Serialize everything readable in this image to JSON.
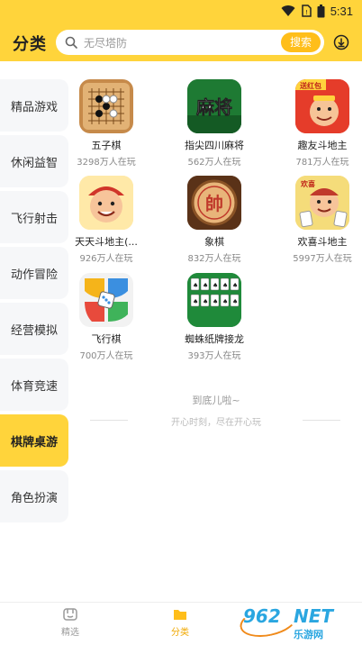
{
  "status_bar": {
    "time": "5:31"
  },
  "header": {
    "title": "分类",
    "search_placeholder": "无尽塔防",
    "search_button": "搜索"
  },
  "sidebar": {
    "items": [
      {
        "label": "精品游戏"
      },
      {
        "label": "休闲益智"
      },
      {
        "label": "飞行射击"
      },
      {
        "label": "动作冒险"
      },
      {
        "label": "经营模拟"
      },
      {
        "label": "体育竞速"
      },
      {
        "label": "棋牌桌游"
      },
      {
        "label": "角色扮演"
      }
    ],
    "active_index": 6
  },
  "games": [
    {
      "name": "五子棋",
      "players": "3298万人在玩",
      "icon": "gomoku-icon"
    },
    {
      "name": "指尖四川麻将",
      "players": "562万人在玩",
      "icon": "mahjong-icon",
      "icon_text": "麻将"
    },
    {
      "name": "趣友斗地主",
      "players": "781万人在玩",
      "icon": "landlord-icon",
      "icon_text": "送红包"
    },
    {
      "name": "天天斗地主(...",
      "players": "926万人在玩",
      "icon": "landlord-face-icon"
    },
    {
      "name": "象棋",
      "players": "832万人在玩",
      "icon": "chinese-chess-icon",
      "icon_text": "帥"
    },
    {
      "name": "欢喜斗地主",
      "players": "5997万人在玩",
      "icon": "happy-landlord-icon",
      "icon_text": "欢喜"
    },
    {
      "name": "飞行棋",
      "players": "700万人在玩",
      "icon": "ludo-icon"
    },
    {
      "name": "蜘蛛纸牌接龙",
      "players": "393万人在玩",
      "icon": "spider-solitaire-icon"
    }
  ],
  "list_end": {
    "text": "到底儿啦~",
    "subtext": "开心时刻，尽在开心玩"
  },
  "bottom_nav": {
    "items": [
      {
        "label": "精选",
        "icon": "featured-icon"
      },
      {
        "label": "分类",
        "icon": "category-icon"
      }
    ],
    "active_index": 1
  },
  "watermark": {
    "number": "962",
    "domain": "NET",
    "text": "乐游网"
  },
  "colors": {
    "accent": "#ffd43b",
    "button": "#ffbe1a",
    "active_nav": "#f0a800"
  }
}
